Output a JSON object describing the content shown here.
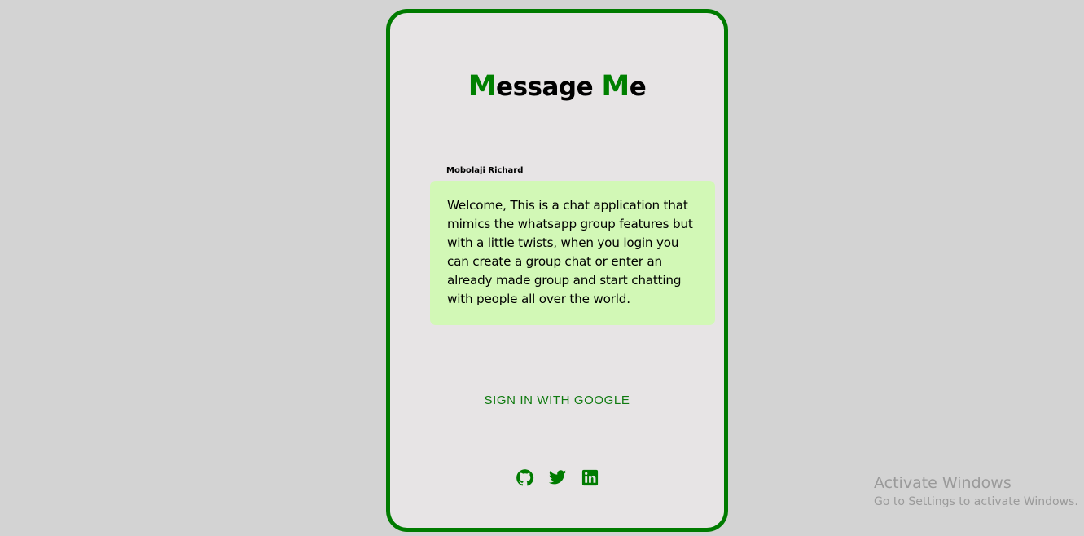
{
  "app": {
    "title_initial_1": "M",
    "title_rest_1": "essage ",
    "title_initial_2": "M",
    "title_rest_2": "e"
  },
  "message": {
    "sender": "Mobolaji Richard",
    "text": "Welcome, This is a chat application that mimics the whatsapp group features but with a little twists, when you login you can create a group chat or enter an already made group and start chatting with people all over the world."
  },
  "auth": {
    "signin_label": "SIGN IN WITH GOOGLE"
  },
  "social": {
    "icons": [
      "github-icon",
      "twitter-icon",
      "linkedin-icon"
    ]
  },
  "watermark": {
    "title": "Activate Windows",
    "subtitle": "Go to Settings to activate Windows."
  },
  "colors": {
    "background": "#d3d3d3",
    "card_background": "#e7e4e5",
    "accent_green": "#008000",
    "bubble_green": "#d2f8b6"
  }
}
